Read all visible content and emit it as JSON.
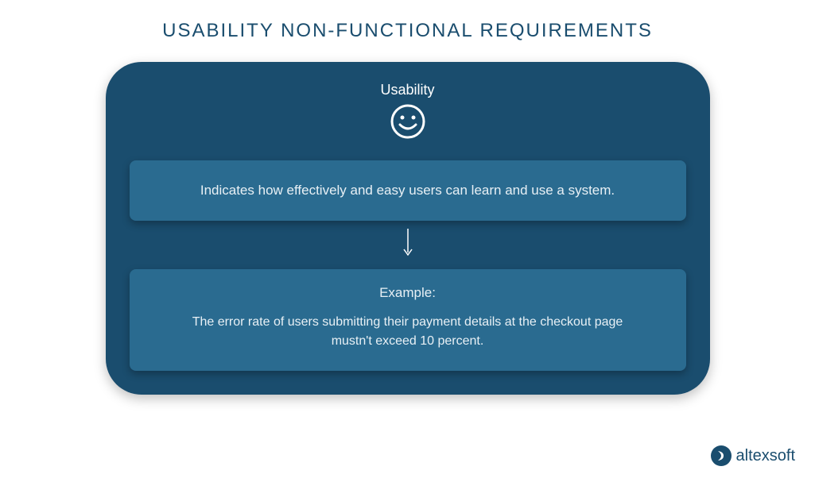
{
  "title": "USABILITY NON-FUNCTIONAL REQUIREMENTS",
  "card": {
    "heading": "Usability",
    "description": "Indicates how effectively and easy users can learn and use a system.",
    "example_label": "Example:",
    "example_text": "The error rate of users submitting their payment details at the checkout page mustn't exceed 10 percent."
  },
  "brand": {
    "name": "altexsoft"
  }
}
